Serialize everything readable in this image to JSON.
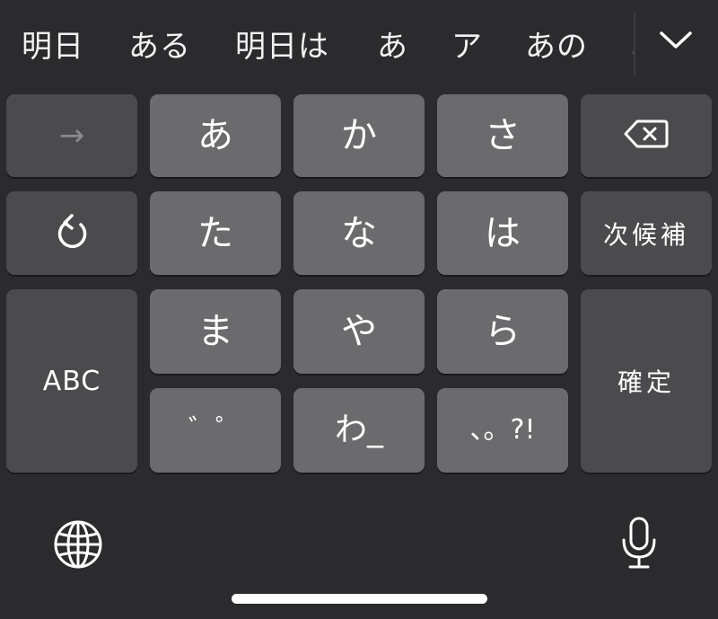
{
  "candidates": [
    "明日",
    "ある",
    "明日は",
    "あ",
    "ア",
    "あの",
    "あ"
  ],
  "keys": {
    "arrow": "→",
    "a": "あ",
    "ka": "か",
    "sa": "さ",
    "ta": "た",
    "na": "な",
    "ha": "は",
    "next_candidate": "次候補",
    "abc": "ABC",
    "ma": "ま",
    "ya": "や",
    "ra": "ら",
    "confirm": "確定",
    "dakuten": "゛゜",
    "wa": "わ_",
    "punct": "、。?!"
  },
  "icons": {
    "collapse": "chevron-down-icon",
    "delete": "delete-icon",
    "undo": "undo-icon",
    "globe": "globe-icon",
    "mic": "microphone-icon"
  },
  "colors": {
    "background": "#2b2b2d",
    "key_dark": "#4b4b4d",
    "key_light": "#6b6b6d",
    "text": "#ffffff"
  }
}
